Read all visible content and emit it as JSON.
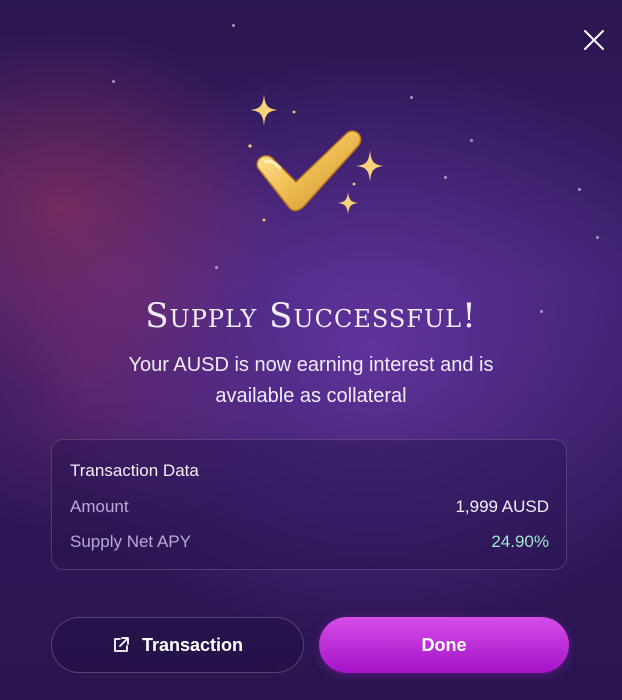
{
  "modal": {
    "title": "Supply Successful!",
    "subtitle_line1": "Your AUSD is now earning interest and is",
    "subtitle_line2": "available as collateral"
  },
  "transaction_data": {
    "heading": "Transaction Data",
    "rows": [
      {
        "label": "Amount",
        "value": "1,999 AUSD"
      },
      {
        "label": "Supply Net APY",
        "value": "24.90%"
      }
    ]
  },
  "buttons": {
    "transaction_label": "Transaction",
    "done_label": "Done"
  },
  "icons": {
    "close": "close-icon",
    "external_link": "external-link-icon",
    "success": "checkmark-sparkles-icon"
  },
  "colors": {
    "accent": "#c02ee0",
    "apy": "#9fe8c8"
  }
}
